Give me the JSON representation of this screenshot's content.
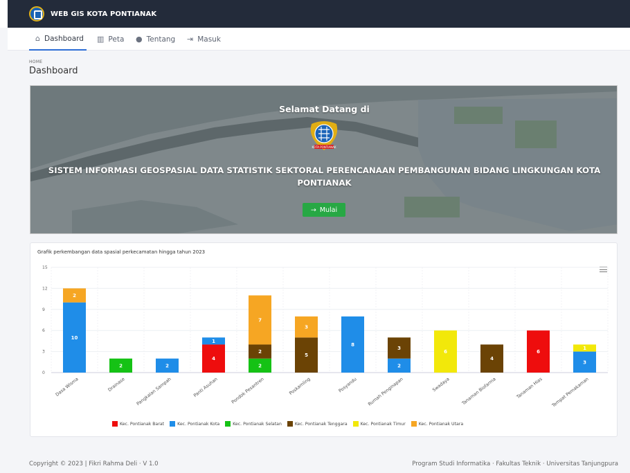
{
  "app": {
    "brand": "WEB GIS KOTA PONTIANAK"
  },
  "nav": [
    {
      "label": "Dashboard",
      "icon": "home-icon"
    },
    {
      "label": "Peta",
      "icon": "map-icon"
    },
    {
      "label": "Tentang",
      "icon": "info-icon"
    },
    {
      "label": "Masuk",
      "icon": "login-icon"
    }
  ],
  "breadcrumb": "HOME",
  "page_title": "Dashboard",
  "hero": {
    "welcome": "Selamat Datang di",
    "title": "SISTEM INFORMASI GEOSPASIAL DATA STATISTIK SEKTORAL PERENCANAAN PEMBANGUNAN BIDANG LINGKUNGAN KOTA PONTIANAK",
    "button": "Mulai",
    "emblem_text": "KOTA PONTIANAK"
  },
  "chart_card": {
    "title": "Grafik perkembangan data spasial perkecamatan hingga tahun 2023"
  },
  "chart_data": {
    "type": "bar",
    "stacked": true,
    "ylim": [
      0,
      15
    ],
    "yticks": [
      0,
      3,
      6,
      9,
      12,
      15
    ],
    "grid": true,
    "legend_position": "bottom",
    "categories": [
      "Dasa Wisma",
      "Drainase",
      "Pangkalan Sampah",
      "Panti Asuhan",
      "Pondok Pesantren",
      "Poskamling",
      "Posyandu",
      "Rumah Penginapan",
      "Swadaya",
      "Tanaman Biofarma",
      "Tanaman Hias",
      "Tempat Pemakaman"
    ],
    "series": [
      {
        "name": "Kec. Pontianak Barat",
        "color": "#ee0d0d",
        "values": [
          0,
          0,
          0,
          4,
          0,
          0,
          0,
          0,
          0,
          0,
          6,
          0
        ]
      },
      {
        "name": "Kec. Pontianak Kota",
        "color": "#1f8de8",
        "values": [
          10,
          0,
          2,
          1,
          0,
          0,
          8,
          2,
          0,
          0,
          0,
          3
        ]
      },
      {
        "name": "Kec. Pontianak Selatan",
        "color": "#15c215",
        "values": [
          0,
          2,
          0,
          0,
          2,
          0,
          0,
          0,
          0,
          0,
          0,
          0
        ]
      },
      {
        "name": "Kec. Pontianak Tenggara",
        "color": "#6b4305",
        "values": [
          0,
          0,
          0,
          0,
          2,
          5,
          0,
          3,
          0,
          4,
          0,
          0
        ]
      },
      {
        "name": "Kec. Pontianak Timur",
        "color": "#f2e80a",
        "values": [
          0,
          0,
          0,
          0,
          0,
          0,
          0,
          0,
          6,
          0,
          0,
          1
        ]
      },
      {
        "name": "Kec. Pontianak Utara",
        "color": "#f6a623",
        "values": [
          2,
          0,
          0,
          0,
          7,
          3,
          0,
          0,
          0,
          0,
          0,
          0
        ]
      }
    ]
  },
  "footer": {
    "left": "Copyright © 2023 | Fikri Rahma Deli  ·  V 1.0",
    "right": "Program Studi Informatika  ·  Fakultas Teknik  ·  Universitas Tanjungpura"
  }
}
